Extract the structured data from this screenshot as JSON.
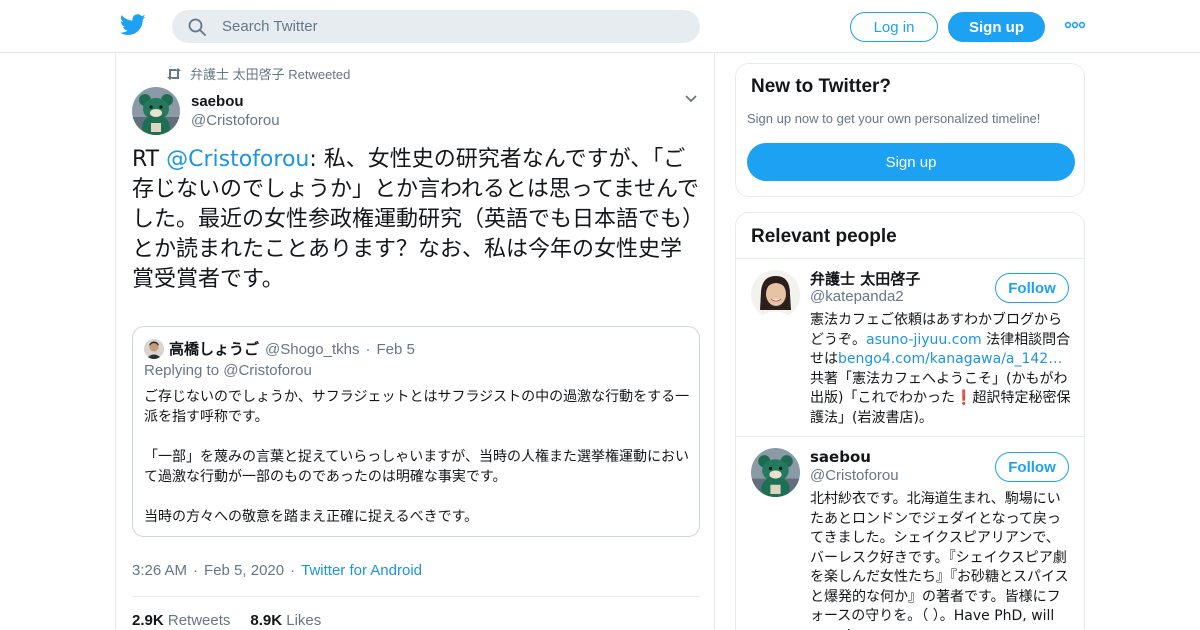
{
  "header": {
    "search_placeholder": "Search Twitter",
    "login_label": "Log in",
    "signup_label": "Sign up",
    "brand_color": "#1da1f2"
  },
  "tweet": {
    "retweeted_by": "弁護士 太田啓子 Retweeted",
    "author_name": "saebou",
    "author_handle": "@Cristoforou",
    "text_prefix": "RT ",
    "text_mention": "@Cristoforou",
    "text_body": ": 私、女性史の研究者なんですが、「ご存じないのでしょうか」とか言われるとは思ってませんでした。最近の女性参政権運動研究（英語でも日本語でも）とか読まれたことあります？なお、私は今年の女性史学賞受賞者です。",
    "quote": {
      "author_name": "高橋しょうご",
      "author_handle": "@Shogo_tkhs",
      "date": "Feb 5",
      "replying_to": "Replying to @Cristoforou",
      "paragraphs": [
        "ご存じないのでしょうか、サフラジェットとはサフラジストの中の過激な行動をする一派を指す呼称です。",
        "「一部」を蔑みの言葉と捉えていらっしゃいますが、当時の人権また選挙権運動において過激な行動が一部のものであったのは明確な事実です。",
        "当時の方々への敬意を踏まえ正確に捉えるべきです。"
      ]
    },
    "time": "3:26 AM",
    "date": "Feb 5, 2020",
    "client": "Twitter for Android",
    "retweets_count": "2.9K",
    "retweets_label": "Retweets",
    "likes_count": "8.9K",
    "likes_label": "Likes"
  },
  "sidebar": {
    "new_title": "New to Twitter?",
    "new_subtitle": "Sign up now to get your own personalized timeline!",
    "new_signup_label": "Sign up",
    "relevant_title": "Relevant people",
    "people": [
      {
        "name": "弁護士 太田啓子",
        "handle": "@katepanda2",
        "follow_label": "Follow",
        "bio_1": "憲法カフェご依頼はあすわかブログからどうぞ。",
        "bio_link_1": "asuno-jiyuu.com",
        "bio_2": " 法律相談問合せは",
        "bio_link_2": "bengo4.com/kanagawa/a_142…",
        "bio_3": " 共著「憲法カフェへようこそ」(かもがわ出版)「これでわかった",
        "bio_excl": "❗",
        "bio_4": "超訳特定秘密保護法」(岩波書店)。"
      },
      {
        "name": "saebou",
        "handle": "@Cristoforou",
        "follow_label": "Follow",
        "bio": "北村紗衣です。北海道生まれ、駒場にいたあとロンドンでジェダイとなって戻ってきました。シェイクスピアリアンで、バーレスク好きです。『シェイクスピア劇を楽しんだ女性たち』『お砂糖とスパイスと爆発的な何か』の著者です。皆様にフォースの守りを。（ ）。Have PhD, will travel."
      }
    ]
  }
}
